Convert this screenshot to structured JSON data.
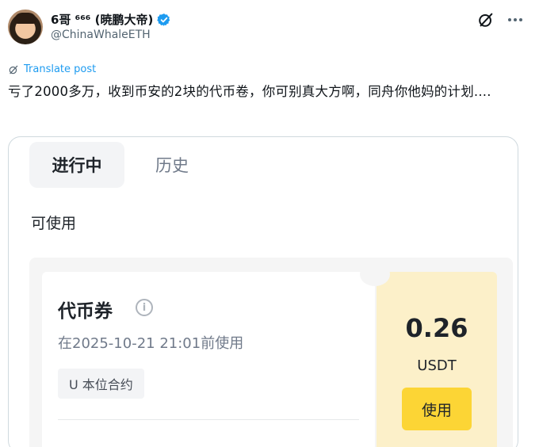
{
  "author": {
    "display_name": "6哥 ⁶⁶⁶ (暁鹏大帝)",
    "handle": "@ChinaWhaleETH"
  },
  "translate_label": "Translate post",
  "post_text": "亏了2000多万，收到币安的2块的代币卷，你可别真大方啊，同舟你他妈的计划....",
  "screenshot": {
    "tabs": [
      {
        "label": "进行中",
        "active": true
      },
      {
        "label": "历史",
        "active": false
      }
    ],
    "section_label": "可使用",
    "coupon": {
      "title": "代币券",
      "expiry": "在2025-10-21 21:01前使用",
      "tag": "U 本位合约",
      "amount": "0.26",
      "unit": "USDT",
      "use_label": "使用"
    }
  },
  "colors": {
    "verified": "#1d9bf0",
    "link": "#1d9bf0",
    "coupon_bg": "#fcf0c9",
    "use_button": "#fcd535"
  },
  "icons": [
    "verified-badge-icon",
    "grok-icon",
    "more-icon",
    "translate-icon",
    "info-icon"
  ]
}
